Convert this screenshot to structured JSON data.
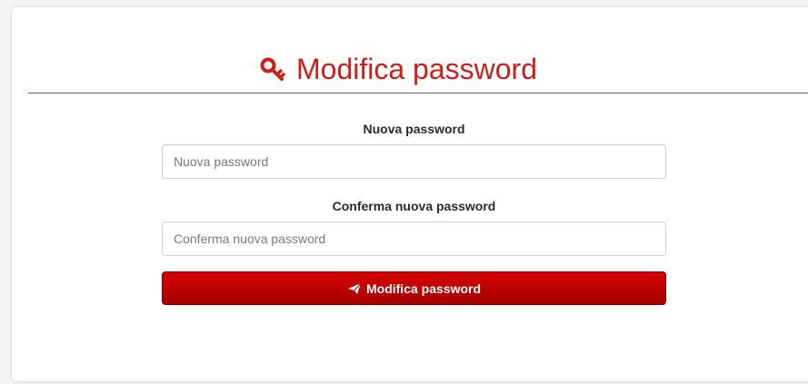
{
  "colors": {
    "accent": "#cc1f1a",
    "button_top": "#d40000",
    "button_bottom": "#a50000",
    "page_background": "#f4f4f4",
    "card_background": "#ffffff"
  },
  "header": {
    "icon": "key-icon",
    "title": "Modifica password"
  },
  "form": {
    "new_password": {
      "label": "Nuova password",
      "placeholder": "Nuova password",
      "value": ""
    },
    "confirm_password": {
      "label": "Conferma nuova password",
      "placeholder": "Conferma nuova password",
      "value": ""
    },
    "submit": {
      "icon": "paper-plane-icon",
      "label": "Modifica password"
    }
  }
}
